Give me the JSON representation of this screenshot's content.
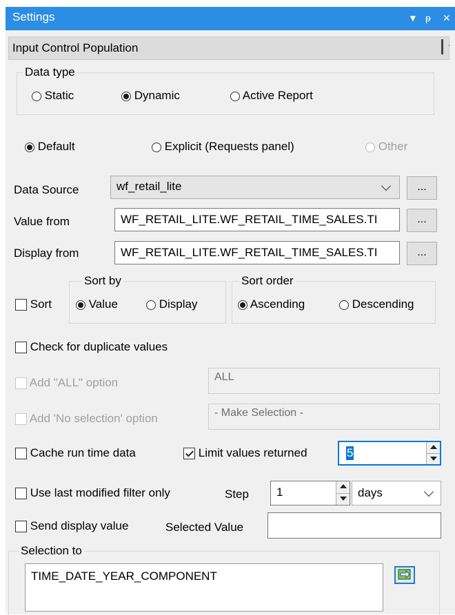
{
  "window": {
    "title": "Settings",
    "btn_dropdown": "▼",
    "btn_pin": "ᵽ",
    "btn_close": "✕"
  },
  "section": {
    "title": "Input Control Population",
    "tick": "·"
  },
  "data_type": {
    "legend": "Data type",
    "options": [
      "Static",
      "Dynamic",
      "Active Report"
    ],
    "selected": "Dynamic"
  },
  "population": {
    "options": [
      "Default",
      "Explicit (Requests panel)",
      "Other"
    ],
    "selected": "Default"
  },
  "data_source": {
    "label": "Data Source",
    "value": "wf_retail_lite",
    "browse": "..."
  },
  "value_from": {
    "label": "Value from",
    "value": "WF_RETAIL_LITE.WF_RETAIL_TIME_SALES.TI",
    "browse": "..."
  },
  "display_from": {
    "label": "Display from",
    "value": "WF_RETAIL_LITE.WF_RETAIL_TIME_SALES.TI",
    "browse": "..."
  },
  "sort": {
    "label": "Sort",
    "sort_by_legend": "Sort by",
    "sort_by_options": [
      "Value",
      "Display"
    ],
    "sort_by_selected": "Value",
    "sort_order_legend": "Sort order",
    "sort_order_options": [
      "Ascending",
      "Descending"
    ],
    "sort_order_selected": "Ascending"
  },
  "check_duplicates": {
    "label": "Check for duplicate values",
    "checked": false
  },
  "add_all": {
    "label": "Add \"ALL\" option",
    "value": "ALL"
  },
  "add_no_selection": {
    "label": "Add 'No selection' option",
    "value": "- Make Selection -"
  },
  "cache": {
    "label": "Cache run time data",
    "checked": false
  },
  "limit": {
    "label": "Limit values returned",
    "checked": true,
    "value": "5"
  },
  "last_modified": {
    "label": "Use last modified filter only",
    "checked": false
  },
  "step": {
    "label": "Step",
    "value": "1",
    "unit": "days"
  },
  "send_display": {
    "label": "Send display value",
    "checked": false
  },
  "selected_value": {
    "label": "Selected Value",
    "value": ""
  },
  "selection_to": {
    "legend": "Selection to",
    "value": "TIME_DATE_YEAR_COMPONENT"
  }
}
